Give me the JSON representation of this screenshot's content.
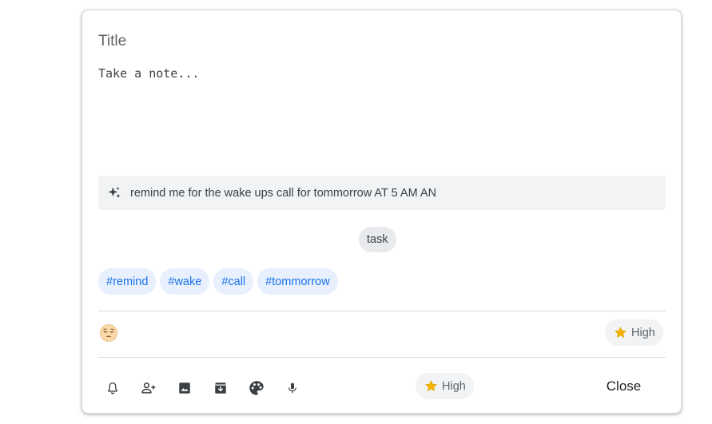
{
  "note": {
    "title_placeholder": "Title",
    "body_placeholder": "Take a note..."
  },
  "ai_suggestion": {
    "icon": "sparkle-icon",
    "text": "remind me for the wake ups call for tommorrow AT 5 AM AN"
  },
  "category": {
    "label": "task"
  },
  "tags": [
    {
      "label": "#remind"
    },
    {
      "label": "#wake"
    },
    {
      "label": "#call"
    },
    {
      "label": "#tommorrow"
    }
  ],
  "mood": {
    "icon": "pensive-face-icon"
  },
  "priority": {
    "icon": "star-icon",
    "label": "High"
  },
  "toolbar": {
    "items": [
      {
        "icon": "bell-icon",
        "name": "remind-me"
      },
      {
        "icon": "add-person-icon",
        "name": "collaborator"
      },
      {
        "icon": "image-icon",
        "name": "add-image"
      },
      {
        "icon": "archive-icon",
        "name": "archive"
      },
      {
        "icon": "palette-icon",
        "name": "background-options"
      },
      {
        "icon": "mic-icon",
        "name": "voice-input"
      }
    ],
    "priority_label": "High",
    "close_label": "Close"
  },
  "colors": {
    "tag_bg": "#e8f0fe",
    "tag_text": "#1a73e8",
    "chip_bg": "#f1f3f4",
    "star": "#f4b400",
    "icon": "#5f6368"
  }
}
